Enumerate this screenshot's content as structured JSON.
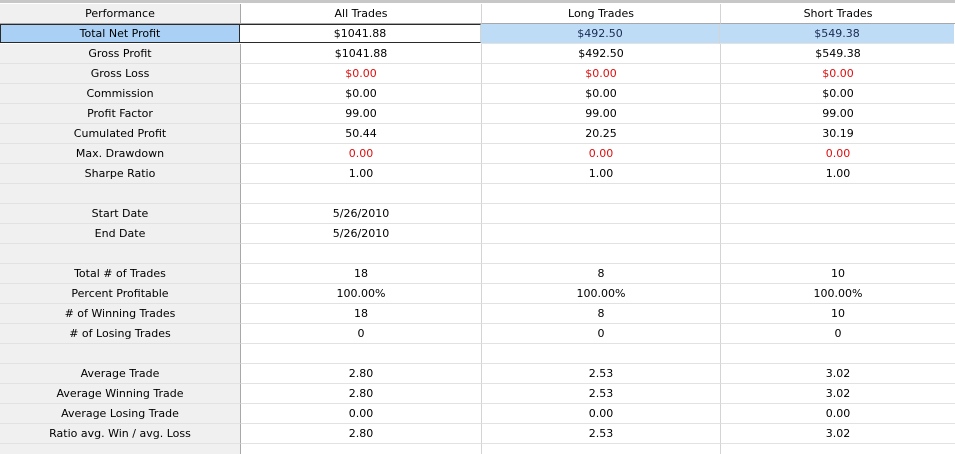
{
  "headers": [
    "Performance",
    "All Trades",
    "Long Trades",
    "Short Trades"
  ],
  "rows": [
    {
      "label": "Total Net Profit",
      "all": "$1041.88",
      "long": "$492.50",
      "short": "$549.38",
      "neg": false,
      "selected": true
    },
    {
      "label": "Gross Profit",
      "all": "$1041.88",
      "long": "$492.50",
      "short": "$549.38",
      "neg": false
    },
    {
      "label": "Gross Loss",
      "all": "$0.00",
      "long": "$0.00",
      "short": "$0.00",
      "neg": true
    },
    {
      "label": "Commission",
      "all": "$0.00",
      "long": "$0.00",
      "short": "$0.00",
      "neg": false
    },
    {
      "label": "Profit Factor",
      "all": "99.00",
      "long": "99.00",
      "short": "99.00",
      "neg": false
    },
    {
      "label": "Cumulated Profit",
      "all": "50.44",
      "long": "20.25",
      "short": "30.19",
      "neg": false
    },
    {
      "label": "Max. Drawdown",
      "all": "0.00",
      "long": "0.00",
      "short": "0.00",
      "neg": true
    },
    {
      "label": "Sharpe Ratio",
      "all": "1.00",
      "long": "1.00",
      "short": "1.00",
      "neg": false
    },
    {
      "label": "",
      "all": "",
      "long": "",
      "short": "",
      "neg": false
    },
    {
      "label": "Start Date",
      "all": "5/26/2010",
      "long": "",
      "short": "",
      "neg": false
    },
    {
      "label": "End Date",
      "all": "5/26/2010",
      "long": "",
      "short": "",
      "neg": false
    },
    {
      "label": "",
      "all": "",
      "long": "",
      "short": "",
      "neg": false
    },
    {
      "label": "Total # of Trades",
      "all": "18",
      "long": "8",
      "short": "10",
      "neg": false
    },
    {
      "label": "Percent Profitable",
      "all": "100.00%",
      "long": "100.00%",
      "short": "100.00%",
      "neg": false
    },
    {
      "label": "# of Winning Trades",
      "all": "18",
      "long": "8",
      "short": "10",
      "neg": false
    },
    {
      "label": "# of Losing Trades",
      "all": "0",
      "long": "0",
      "short": "0",
      "neg": false
    },
    {
      "label": "",
      "all": "",
      "long": "",
      "short": "",
      "neg": false
    },
    {
      "label": "Average Trade",
      "all": "2.80",
      "long": "2.53",
      "short": "3.02",
      "neg": false
    },
    {
      "label": "Average Winning Trade",
      "all": "2.80",
      "long": "2.53",
      "short": "3.02",
      "neg": false
    },
    {
      "label": "Average Losing Trade",
      "all": "0.00",
      "long": "0.00",
      "short": "0.00",
      "neg": false
    },
    {
      "label": "Ratio avg. Win / avg. Loss",
      "all": "2.80",
      "long": "2.53",
      "short": "3.02",
      "neg": false
    },
    {
      "label": "",
      "all": "",
      "long": "",
      "short": "",
      "neg": false
    }
  ],
  "colors": {
    "negative": "#e01010",
    "selection": "#aad0f5",
    "header_bg": "#f0f0f0"
  }
}
